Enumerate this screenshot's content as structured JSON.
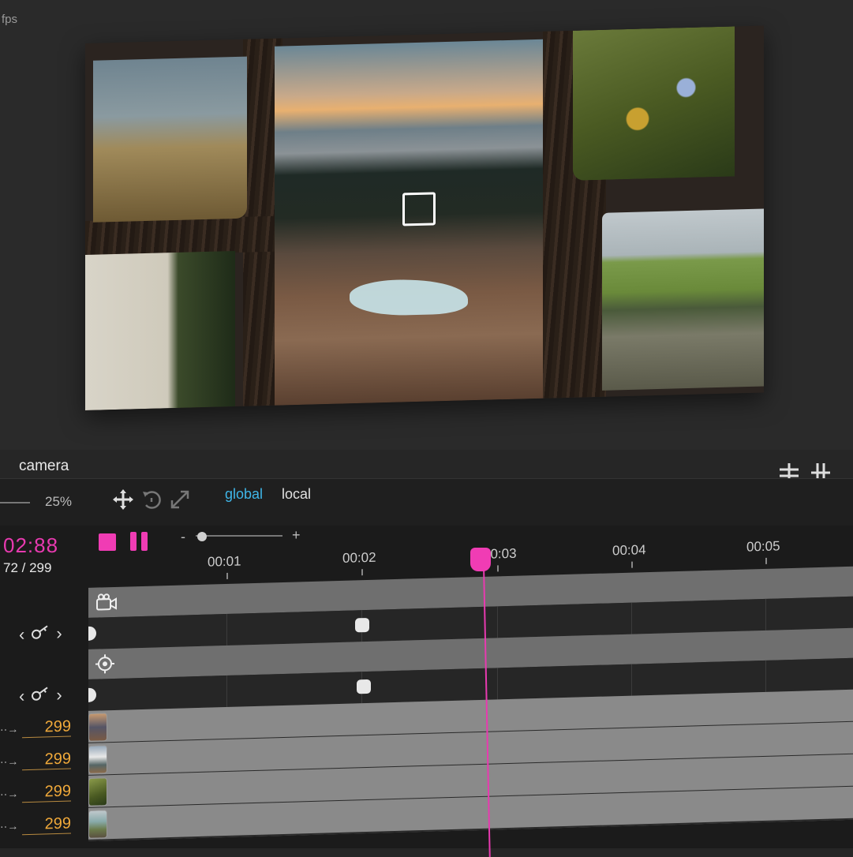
{
  "viewport": {
    "fps_label": "fps"
  },
  "camera_panel": {
    "title": "camera",
    "zoom_value": "25%",
    "modes": {
      "global": "global",
      "local": "local"
    }
  },
  "timeline": {
    "timecode": "02:88",
    "frame_counter": "72 / 299",
    "zoom_minus": "-",
    "zoom_plus": "+",
    "ruler": [
      "00:01",
      "00:02",
      "00:03",
      "00:04",
      "00:05"
    ],
    "layers": [
      {
        "duration": "299"
      },
      {
        "duration": "299"
      },
      {
        "duration": "299"
      },
      {
        "duration": "299"
      }
    ]
  },
  "colors": {
    "accent": "#f03cb4",
    "global_mode": "#3fb6e8",
    "duration": "#f0a93a"
  },
  "icons": [
    "move-icon",
    "rotate-icon",
    "scale-icon",
    "split-tracks-icon",
    "merge-tracks-icon",
    "camera-video-icon",
    "target-icon",
    "key-icon",
    "chevron-left-icon",
    "chevron-right-icon"
  ]
}
